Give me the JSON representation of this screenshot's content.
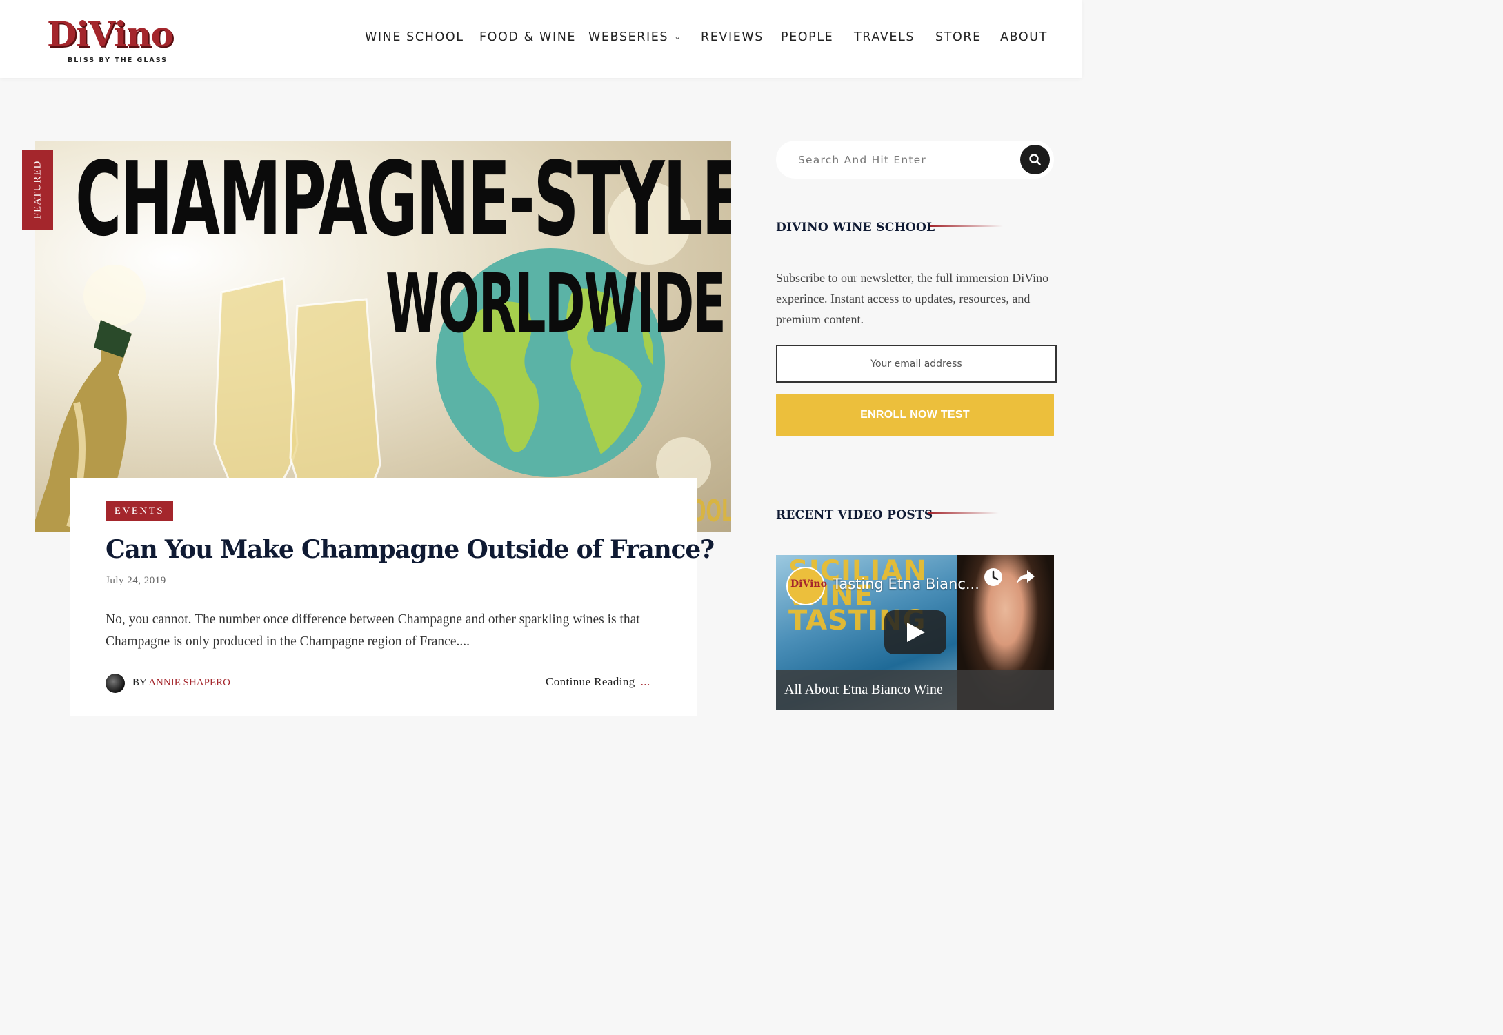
{
  "brand": {
    "logo_text": "DiVino",
    "tagline": "BLISS BY THE GLASS",
    "accent_color": "#a4262c",
    "cta_color": "#ecbf3c"
  },
  "nav": {
    "items": [
      "WINE SCHOOL",
      "FOOD & WINE",
      "WEBSERIES",
      "REVIEWS",
      "PEOPLE",
      "TRAVELS",
      "STORE",
      "ABOUT"
    ],
    "dropdown_item": "WEBSERIES"
  },
  "featured": {
    "tag": "FEATURED",
    "image_line1": "CHAMPAGNE-STYLE",
    "image_line2": "WORLDWIDE",
    "image_corner_text": "OOL"
  },
  "post": {
    "category": "EVENTS",
    "title": "Can You Make Champagne Outside of France?",
    "date": "July 24, 2019",
    "excerpt": "No, you cannot.  The number once difference between Champagne and other sparkling wines is that Champagne is only produced in the Champagne region of France....",
    "by_label": "BY",
    "author": "ANNIE SHAPERO",
    "continue_label": "Continue Reading",
    "continue_suffix": "..."
  },
  "sidebar": {
    "search_placeholder": "Search And Hit Enter",
    "school_title": "DIVINO WINE SCHOOL",
    "newsletter_text": "Subscribe to our newsletter, the full immersion DiVino experince. Instant access to updates, resources, and premium content.",
    "email_placeholder": "Your email address",
    "enroll_label": "ENROLL NOW TEST",
    "videos_title": "RECENT VIDEO POSTS",
    "video": {
      "player_title": "Tasting Etna Bianc...",
      "channel_logo_text": "DiVino",
      "thumb_text": "SICILIAN WINE TASTING",
      "caption": "All About Etna Bianco Wine"
    }
  }
}
